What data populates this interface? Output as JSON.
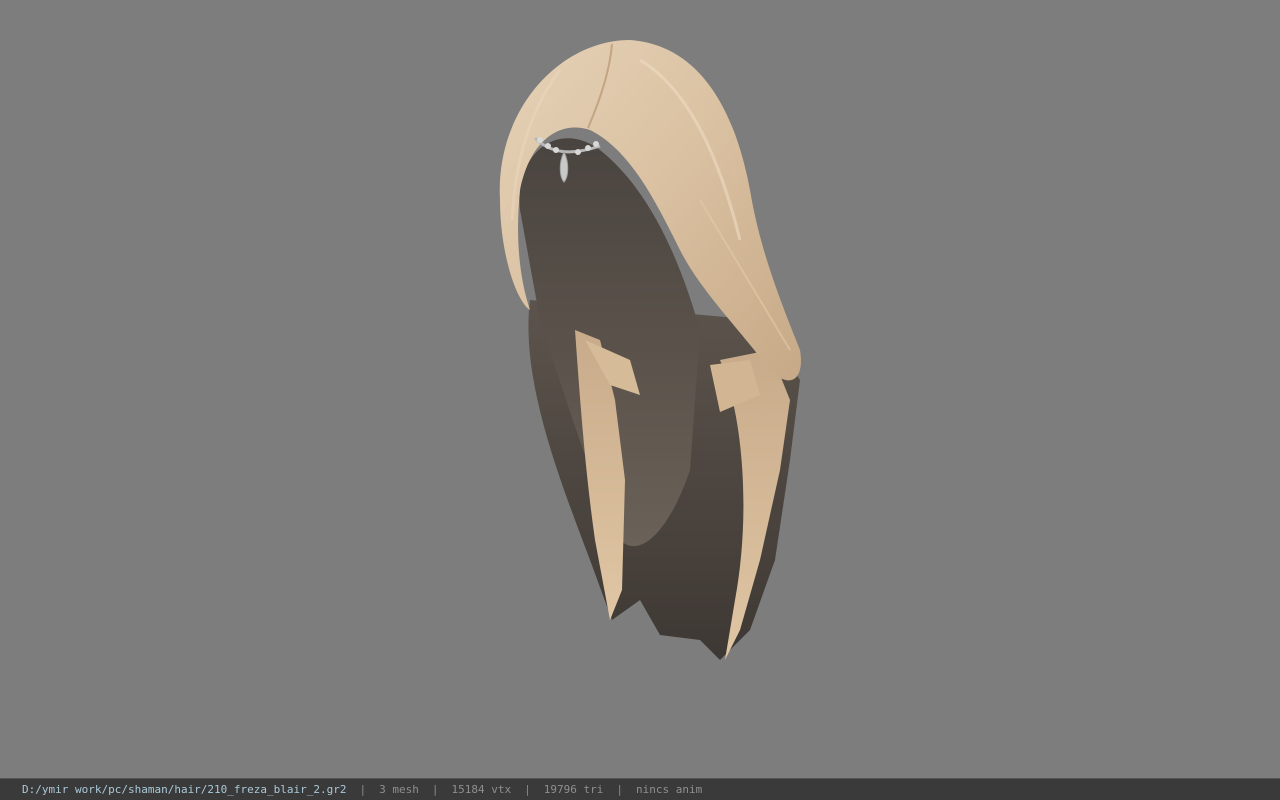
{
  "viewer": {
    "background_color": "#7d7d7d",
    "model_icon": "hair-model-icon",
    "accessory_icon": "jewel-pendant-icon"
  },
  "status": {
    "file_path": "D:/ymir work/pc/shaman/hair/210_freza_blair_2.gr2",
    "separator": "|",
    "mesh_count": "3 mesh",
    "vertex_count": "15184 vtx",
    "triangle_count": "19796 tri",
    "anim_status": "nincs anim",
    "path_color": "#a9c9d9",
    "text_color": "#8f8f8f"
  }
}
